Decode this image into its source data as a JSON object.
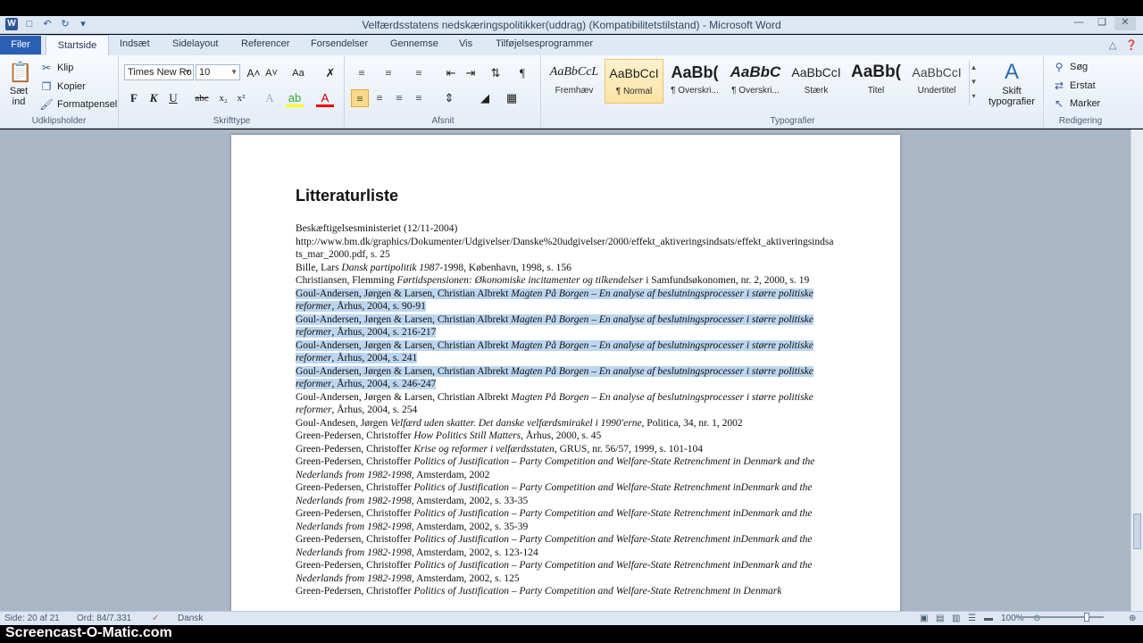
{
  "window": {
    "title": "Velfærdsstatens nedskæringspolitikker(uddrag) (Kompatibilitetstilstand) - Microsoft Word",
    "logo": "W"
  },
  "tabs": {
    "file": "Filer",
    "items": [
      "Startside",
      "Indsæt",
      "Sidelayout",
      "Referencer",
      "Forsendelser",
      "Gennemse",
      "Vis",
      "Tilføjelsesprogrammer"
    ]
  },
  "ribbon": {
    "clipboard": {
      "paste": "Sæt ind",
      "cut": "Klip",
      "copy": "Kopier",
      "format_painter": "Formatpensel",
      "label": "Udklipsholder"
    },
    "font": {
      "name": "Times New Ro",
      "size": "10",
      "label": "Skrifttype",
      "bold": "F",
      "italic": "K",
      "underline": "U"
    },
    "paragraph": {
      "label": "Afsnit"
    },
    "styles": {
      "label": "Typografier",
      "items": [
        {
          "sample": "AaBbCcL",
          "name": "Fremhæv"
        },
        {
          "sample": "AaBbCcI",
          "name": "¶ Normal"
        },
        {
          "sample": "AaBb(",
          "name": "¶ Overskri..."
        },
        {
          "sample": "AaBbC",
          "name": "¶ Overskri..."
        },
        {
          "sample": "AaBbCcI",
          "name": "Stærk"
        },
        {
          "sample": "AaBb(",
          "name": "Titel"
        },
        {
          "sample": "AaBbCcI",
          "name": "Undertitel"
        }
      ],
      "change": "Skift typografier"
    },
    "editing": {
      "find": "Søg",
      "replace": "Erstat",
      "select": "Marker",
      "label": "Redigering"
    }
  },
  "document": {
    "heading": "Litteraturliste",
    "refs": [
      {
        "hl": false,
        "parts": [
          [
            "n",
            "Beskæftigelsesministeriet  (12/11-2004) http://www.bm.dk/graphics/Dokumenter/Udgivelser/Danske%20udgivelser/2000/effekt_aktiveringsindsats/effekt_aktiveringsindsats_mar_2000.pdf, s. 25"
          ]
        ]
      },
      {
        "hl": false,
        "parts": [
          [
            "n",
            "Bille,  Lars "
          ],
          [
            "i",
            "Dansk partipolitik 1987"
          ],
          [
            "n",
            "-1998, København, 1998, s. 156"
          ]
        ]
      },
      {
        "hl": false,
        "parts": [
          [
            "n",
            "Christiansen, Flemming "
          ],
          [
            "i",
            "Førtidspensionen: Økonomiske incitamenter og tilkendelser"
          ],
          [
            "n",
            " i  Samfundsøkonomen, nr. 2, 2000, s. 19"
          ]
        ]
      },
      {
        "hl": true,
        "parts": [
          [
            "n",
            "Goul-Andersen,  Jørgen & Larsen, Christian Albrekt "
          ],
          [
            "i",
            "Magten På Borgen – En analyse af beslutningsprocesser i større politiske reformer"
          ],
          [
            "n",
            ", Århus, 2004, s. 90-91"
          ]
        ]
      },
      {
        "hl": true,
        "parts": [
          [
            "n",
            "Goul-Andersen,  Jørgen & Larsen, Christian Albrekt "
          ],
          [
            "i",
            "Magten På Borgen – En analyse af beslutningsprocesser i større politiske reformer"
          ],
          [
            "n",
            ", Århus, 2004, s. 216-217"
          ]
        ]
      },
      {
        "hl": true,
        "parts": [
          [
            "n",
            "Goul-Andersen,  Jørgen & Larsen, Christian Albrekt "
          ],
          [
            "i",
            "Magten På Borgen – En analyse af beslutningsprocesser i større politiske reformer"
          ],
          [
            "n",
            ", Århus, 2004, s. 241"
          ]
        ]
      },
      {
        "hl": true,
        "parts": [
          [
            "n",
            "Goul-Andersen,  Jørgen & Larsen, Christian Albrekt "
          ],
          [
            "i",
            "Magten På Borgen – En analyse af beslutningsprocesser i større politiske reformer"
          ],
          [
            "n",
            ", Århus, 2004, s. 246-247"
          ]
        ]
      },
      {
        "hl": false,
        "parts": [
          [
            "n",
            "Goul-Andersen,  Jørgen & Larsen, Christian Albrekt "
          ],
          [
            "i",
            "Magten På Borgen – En analyse af beslutningsprocesser i større politiske reformer"
          ],
          [
            "n",
            ", Århus, 2004, s. 254"
          ]
        ]
      },
      {
        "hl": false,
        "parts": [
          [
            "n",
            "Goul-Andesen, Jørgen "
          ],
          [
            "i",
            "Velfærd uden skatter. Det danske velfærdsmirakel i 1990'erne"
          ],
          [
            "n",
            ", Politica, 34, nr. 1, 2002"
          ]
        ]
      },
      {
        "hl": false,
        "parts": [
          [
            "n",
            "Green-Pedersen,  Christoffer "
          ],
          [
            "i",
            "How Politics Still Matters"
          ],
          [
            "n",
            ", Århus, 2000, s. 45"
          ]
        ]
      },
      {
        "hl": false,
        "parts": [
          [
            "n",
            "Green-Pedersen,  Christoffer "
          ],
          [
            "i",
            "Krise og reformer i velfærdsstaten"
          ],
          [
            "n",
            ", GRUS, nr. 56/57, 1999, s. 101-104"
          ]
        ]
      },
      {
        "hl": false,
        "parts": [
          [
            "n",
            "Green-Pedersen,  Christoffer "
          ],
          [
            "i",
            "Politics of Justification – Party Competition and Welfare-State Retrenchment in Denmark and the Nederlands from 1982-1998"
          ],
          [
            "n",
            ", Amsterdam, 2002"
          ]
        ]
      },
      {
        "hl": false,
        "parts": [
          [
            "n",
            "Green-Pedersen,  Christoffer "
          ],
          [
            "i",
            "Politics of Justification – Party Competition and Welfare-State Retrenchment inDenmark and the Nederlands from 1982-1998"
          ],
          [
            "n",
            ", Amsterdam, 2002, s. 33-35"
          ]
        ]
      },
      {
        "hl": false,
        "parts": [
          [
            "n",
            "Green-Pedersen,  Christoffer "
          ],
          [
            "i",
            "Politics of Justification – Party Competition and Welfare-State Retrenchment inDenmark and the Nederlands from 1982-1998"
          ],
          [
            "n",
            ", Amsterdam, 2002, s. 35-39"
          ]
        ]
      },
      {
        "hl": false,
        "parts": [
          [
            "n",
            "Green-Pedersen,  Christoffer "
          ],
          [
            "i",
            "Politics of Justification – Party Competition and Welfare-State Retrenchment inDenmark and the Nederlands from 1982-1998"
          ],
          [
            "n",
            ", Amsterdam, 2002, s. 123-124"
          ]
        ]
      },
      {
        "hl": false,
        "parts": [
          [
            "n",
            "Green-Pedersen,  Christoffer "
          ],
          [
            "i",
            "Politics of Justification – Party Competition and Welfare-State Retrenchment inDenmark and the Nederlands from 1982-1998"
          ],
          [
            "n",
            ", Amsterdam, 2002, s. 125"
          ]
        ]
      },
      {
        "hl": false,
        "parts": [
          [
            "n",
            "Green-Pedersen,  Christoffer "
          ],
          [
            "i",
            "Politics of Justification – Party Competition and Welfare-State Retrenchment in Denmark"
          ]
        ]
      }
    ]
  },
  "status": {
    "page": "Side: 20 af 21",
    "words": "Ord: 84/7.331",
    "language": "Dansk",
    "zoom": "100%"
  },
  "watermark": "Screencast-O-Matic.com"
}
